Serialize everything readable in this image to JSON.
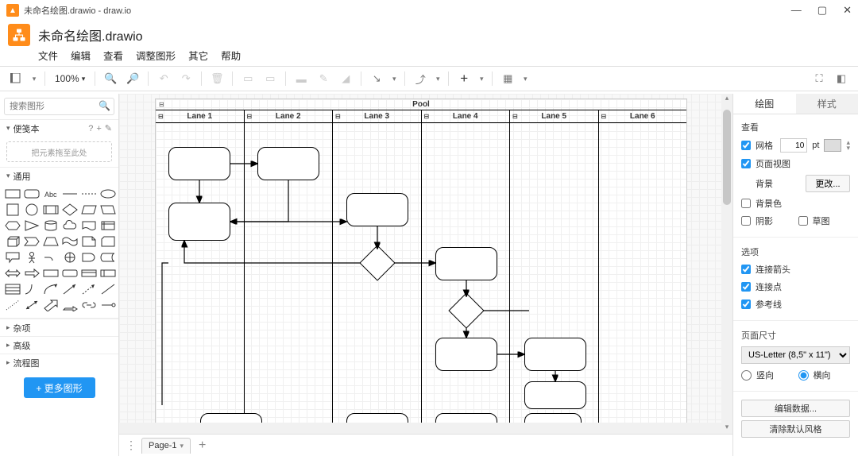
{
  "titlebar": {
    "text": "未命名绘图.drawio - draw.io"
  },
  "window_controls": {
    "min": "—",
    "max": "▢",
    "close": "✕"
  },
  "doc_title": "未命名绘图.drawio",
  "menubar": [
    "文件",
    "编辑",
    "查看",
    "调整图形",
    "其它",
    "帮助"
  ],
  "toolbar": {
    "zoom": "100%"
  },
  "left": {
    "search_placeholder": "搜索图形",
    "scratchpad": {
      "label": "便笺本",
      "hint": "把元素拖至此处",
      "q": "?",
      "plus": "+",
      "pen": "✎"
    },
    "general_label": "通用",
    "cats": [
      "杂项",
      "高级",
      "流程图"
    ],
    "more_shapes": "+ 更多图形"
  },
  "pool": {
    "title": "Pool",
    "lanes": [
      "Lane 1",
      "Lane 2",
      "Lane 3",
      "Lane 4",
      "Lane 5",
      "Lane 6"
    ]
  },
  "page_tab": {
    "label": "Page-1"
  },
  "right": {
    "tabs": [
      "绘图",
      "样式"
    ],
    "view_title": "查看",
    "grid": "网格",
    "grid_size": "10",
    "grid_unit": "pt",
    "page_view": "页面视图",
    "background": "背景",
    "change": "更改...",
    "bg_color": "背景色",
    "shadow": "阴影",
    "sketch": "草图",
    "options_title": "选项",
    "conn_arrows": "连接箭头",
    "conn_points": "连接点",
    "guides": "参考线",
    "page_size_title": "页面尺寸",
    "page_size": "US-Letter (8,5\" x 11\")",
    "portrait": "竖向",
    "landscape": "横向",
    "edit_data": "编辑数据...",
    "clear_style": "清除默认风格"
  }
}
